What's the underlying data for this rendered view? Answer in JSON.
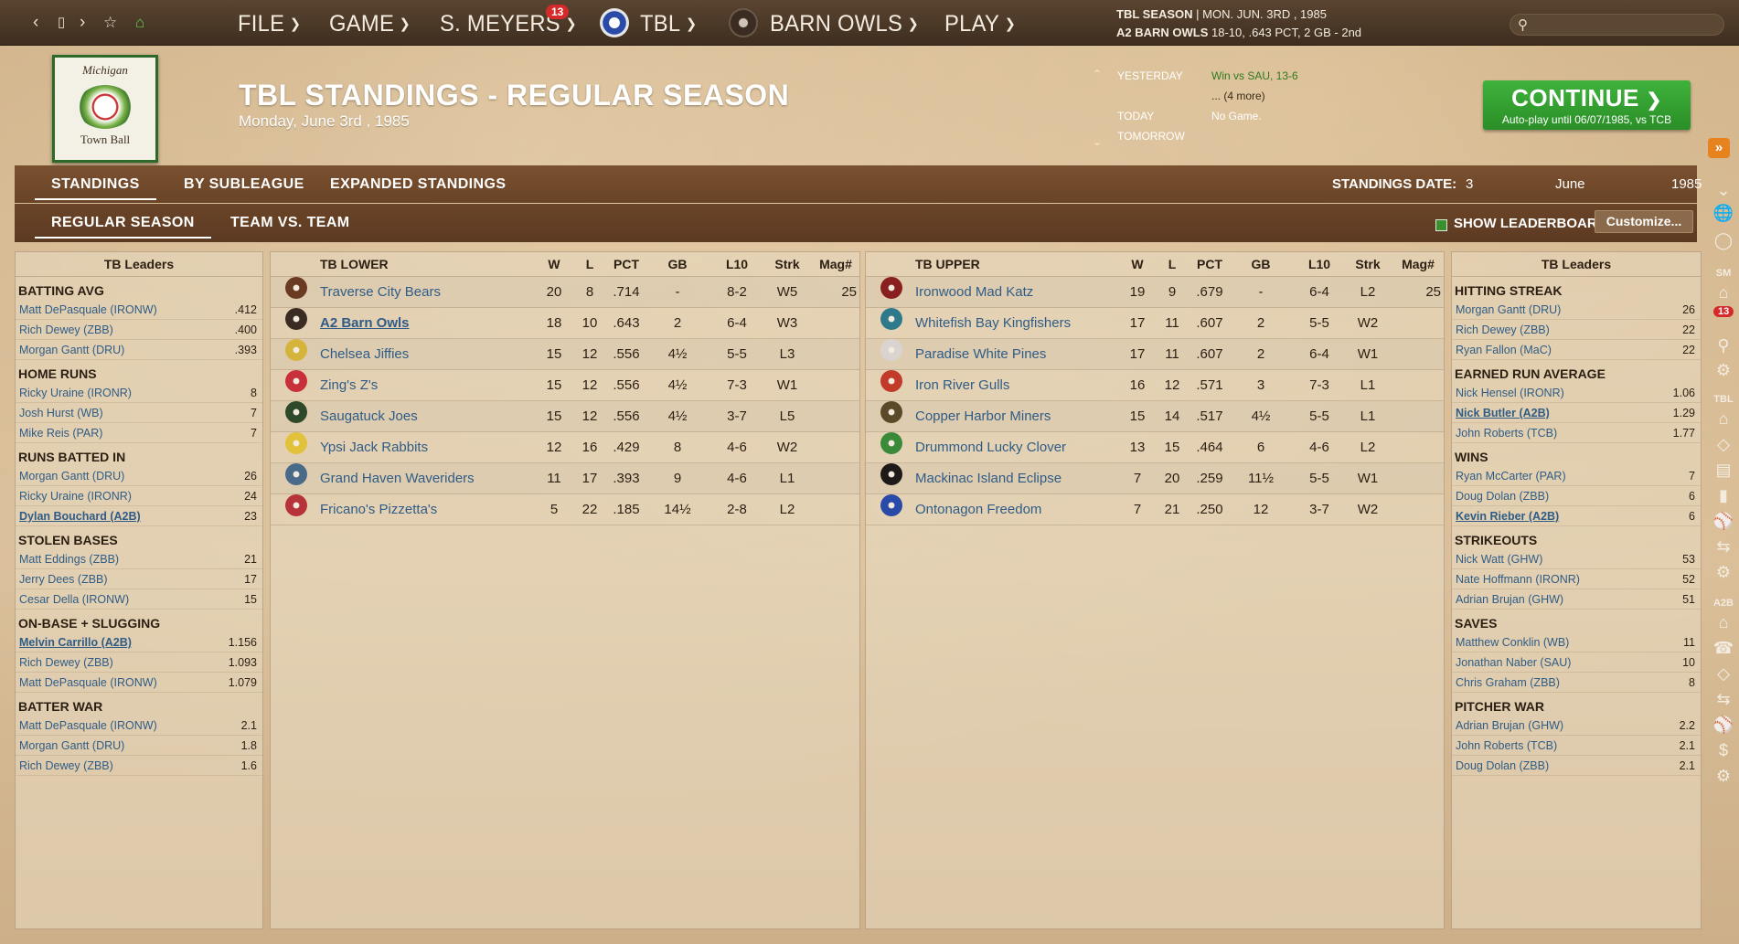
{
  "topbar": {
    "nav_icons": [
      "back-icon",
      "window-icon",
      "forward-icon",
      "star-icon",
      "home-icon"
    ],
    "menus": [
      "FILE",
      "GAME",
      "S. MEYERS",
      "TBL",
      "BARN OWLS",
      "PLAY"
    ],
    "notification_count": "13",
    "season_line1_bold": "TBL SEASON",
    "season_line1_rest": "  |  MON. JUN. 3RD , 1985",
    "season_line2_bold": "A2 BARN OWLS",
    "season_line2_rest": "  18-10, .643 PCT, 2 GB - 2nd"
  },
  "header": {
    "logo_top": "Michigan",
    "logo_bottom": "Town Ball",
    "title": "TBL STANDINGS - REGULAR SEASON",
    "date": "Monday, June 3rd , 1985",
    "schedule": {
      "yesterday_label": "YESTERDAY",
      "yesterday_value": "Win vs SAU, 13-6",
      "more": "... (4 more)",
      "today_label": "TODAY",
      "today_value": "No Game.",
      "tomorrow_label": "TOMORROW"
    },
    "continue_label": "CONTINUE",
    "continue_sub": "Auto-play until 06/07/1985, vs TCB"
  },
  "tabs1": {
    "standings": "STANDINGS",
    "by_subleague": "BY SUBLEAGUE",
    "expanded": "EXPANDED STANDINGS",
    "date_label": "STANDINGS DATE:",
    "day": "3",
    "month": "June",
    "year": "1985"
  },
  "tabs2": {
    "regular": "REGULAR SEASON",
    "team_vs_team": "TEAM VS. TEAM",
    "show_leaderboards": "SHOW LEADERBOARDS",
    "customize": "Customize..."
  },
  "left_leaders": {
    "title": "TB Leaders",
    "categories": [
      {
        "name": "BATTING AVG",
        "rows": [
          [
            "Matt DePasquale (IRONW)",
            ".412",
            false
          ],
          [
            "Rich Dewey (ZBB)",
            ".400",
            false
          ],
          [
            "Morgan Gantt (DRU)",
            ".393",
            false
          ]
        ]
      },
      {
        "name": "HOME RUNS",
        "rows": [
          [
            "Ricky Uraine (IRONR)",
            "8",
            false
          ],
          [
            "Josh Hurst (WB)",
            "7",
            false
          ],
          [
            "Mike Reis (PAR)",
            "7",
            false
          ]
        ]
      },
      {
        "name": "RUNS BATTED IN",
        "rows": [
          [
            "Morgan Gantt (DRU)",
            "26",
            false
          ],
          [
            "Ricky Uraine (IRONR)",
            "24",
            false
          ],
          [
            "Dylan Bouchard (A2B)",
            "23",
            true
          ]
        ]
      },
      {
        "name": "STOLEN BASES",
        "rows": [
          [
            "Matt Eddings (ZBB)",
            "21",
            false
          ],
          [
            "Jerry Dees (ZBB)",
            "17",
            false
          ],
          [
            "Cesar Della (IRONW)",
            "15",
            false
          ]
        ]
      },
      {
        "name": "ON-BASE + SLUGGING",
        "rows": [
          [
            "Melvin Carrillo (A2B)",
            "1.156",
            true
          ],
          [
            "Rich Dewey (ZBB)",
            "1.093",
            false
          ],
          [
            "Matt DePasquale (IRONW)",
            "1.079",
            false
          ]
        ]
      },
      {
        "name": "BATTER WAR",
        "rows": [
          [
            "Matt DePasquale (IRONW)",
            "2.1",
            false
          ],
          [
            "Morgan Gantt (DRU)",
            "1.8",
            false
          ],
          [
            "Rich Dewey (ZBB)",
            "1.6",
            false
          ]
        ]
      }
    ]
  },
  "right_leaders": {
    "title": "TB Leaders",
    "categories": [
      {
        "name": "HITTING STREAK",
        "rows": [
          [
            "Morgan Gantt (DRU)",
            "26",
            false
          ],
          [
            "Rich Dewey (ZBB)",
            "22",
            false
          ],
          [
            "Ryan Fallon (MaC)",
            "22",
            false
          ]
        ]
      },
      {
        "name": "EARNED RUN AVERAGE",
        "rows": [
          [
            "Nick Hensel (IRONR)",
            "1.06",
            false
          ],
          [
            "Nick Butler (A2B)",
            "1.29",
            true
          ],
          [
            "John Roberts (TCB)",
            "1.77",
            false
          ]
        ]
      },
      {
        "name": "WINS",
        "rows": [
          [
            "Ryan McCarter (PAR)",
            "7",
            false
          ],
          [
            "Doug Dolan (ZBB)",
            "6",
            false
          ],
          [
            "Kevin Rieber (A2B)",
            "6",
            true
          ]
        ]
      },
      {
        "name": "STRIKEOUTS",
        "rows": [
          [
            "Nick Watt (GHW)",
            "53",
            false
          ],
          [
            "Nate Hoffmann (IRONR)",
            "52",
            false
          ],
          [
            "Adrian Brujan (GHW)",
            "51",
            false
          ]
        ]
      },
      {
        "name": "SAVES",
        "rows": [
          [
            "Matthew Conklin (WB)",
            "11",
            false
          ],
          [
            "Jonathan Naber (SAU)",
            "10",
            false
          ],
          [
            "Chris Graham (ZBB)",
            "8",
            false
          ]
        ]
      },
      {
        "name": "PITCHER WAR",
        "rows": [
          [
            "Adrian Brujan (GHW)",
            "2.2",
            false
          ],
          [
            "John Roberts (TCB)",
            "2.1",
            false
          ],
          [
            "Doug Dolan (ZBB)",
            "2.1",
            false
          ]
        ]
      }
    ]
  },
  "lower": {
    "title": "TB LOWER",
    "columns": [
      "W",
      "L",
      "PCT",
      "GB",
      "L10",
      "Strk",
      "Mag#"
    ],
    "teams": [
      {
        "name": "Traverse City Bears",
        "w": "20",
        "l": "8",
        "pct": ".714",
        "gb": "-",
        "l10": "8-2",
        "strk": "W5",
        "mag": "25",
        "color": "#6b3a22",
        "ul": false
      },
      {
        "name": "A2 Barn Owls",
        "w": "18",
        "l": "10",
        "pct": ".643",
        "gb": "2",
        "l10": "6-4",
        "strk": "W3",
        "mag": "",
        "color": "#3a2c22",
        "ul": true
      },
      {
        "name": "Chelsea Jiffies",
        "w": "15",
        "l": "12",
        "pct": ".556",
        "gb": "4½",
        "l10": "5-5",
        "strk": "L3",
        "mag": "",
        "color": "#d4b43a",
        "ul": false
      },
      {
        "name": "Zing's Z's",
        "w": "15",
        "l": "12",
        "pct": ".556",
        "gb": "4½",
        "l10": "7-3",
        "strk": "W1",
        "mag": "",
        "color": "#c8313a",
        "ul": false
      },
      {
        "name": "Saugatuck Joes",
        "w": "15",
        "l": "12",
        "pct": ".556",
        "gb": "4½",
        "l10": "3-7",
        "strk": "L5",
        "mag": "",
        "color": "#2e4a2a",
        "ul": false
      },
      {
        "name": "Ypsi Jack Rabbits",
        "w": "12",
        "l": "16",
        "pct": ".429",
        "gb": "8",
        "l10": "4-6",
        "strk": "W2",
        "mag": "",
        "color": "#e2c23a",
        "ul": false
      },
      {
        "name": "Grand Haven Waveriders",
        "w": "11",
        "l": "17",
        "pct": ".393",
        "gb": "9",
        "l10": "4-6",
        "strk": "L1",
        "mag": "",
        "color": "#4a6a8a",
        "ul": false
      },
      {
        "name": "Fricano's Pizzetta's",
        "w": "5",
        "l": "22",
        "pct": ".185",
        "gb": "14½",
        "l10": "2-8",
        "strk": "L2",
        "mag": "",
        "color": "#b8323a",
        "ul": false
      }
    ]
  },
  "upper": {
    "title": "TB UPPER",
    "columns": [
      "W",
      "L",
      "PCT",
      "GB",
      "L10",
      "Strk",
      "Mag#"
    ],
    "teams": [
      {
        "name": "Ironwood Mad Katz",
        "w": "19",
        "l": "9",
        "pct": ".679",
        "gb": "-",
        "l10": "6-4",
        "strk": "L2",
        "mag": "25",
        "color": "#8a1f1f",
        "ul": false
      },
      {
        "name": "Whitefish Bay Kingfishers",
        "w": "17",
        "l": "11",
        "pct": ".607",
        "gb": "2",
        "l10": "5-5",
        "strk": "W2",
        "mag": "",
        "color": "#2f7a8a",
        "ul": false
      },
      {
        "name": "Paradise White Pines",
        "w": "17",
        "l": "11",
        "pct": ".607",
        "gb": "2",
        "l10": "6-4",
        "strk": "W1",
        "mag": "",
        "color": "#d9d4cf",
        "ul": false
      },
      {
        "name": "Iron River Gulls",
        "w": "16",
        "l": "12",
        "pct": ".571",
        "gb": "3",
        "l10": "7-3",
        "strk": "L1",
        "mag": "",
        "color": "#c23a2a",
        "ul": false
      },
      {
        "name": "Copper Harbor Miners",
        "w": "15",
        "l": "14",
        "pct": ".517",
        "gb": "4½",
        "l10": "5-5",
        "strk": "L1",
        "mag": "",
        "color": "#5a4a2a",
        "ul": false
      },
      {
        "name": "Drummond Lucky Clover",
        "w": "13",
        "l": "15",
        "pct": ".464",
        "gb": "6",
        "l10": "4-6",
        "strk": "L2",
        "mag": "",
        "color": "#3a8a3a",
        "ul": false
      },
      {
        "name": "Mackinac Island Eclipse",
        "w": "7",
        "l": "20",
        "pct": ".259",
        "gb": "11½",
        "l10": "5-5",
        "strk": "W1",
        "mag": "",
        "color": "#1e1a18",
        "ul": false
      },
      {
        "name": "Ontonagon Freedom",
        "w": "7",
        "l": "21",
        "pct": ".250",
        "gb": "12",
        "l10": "3-7",
        "strk": "W2",
        "mag": "",
        "color": "#2a4aa8",
        "ul": false
      }
    ]
  },
  "sidebar": {
    "labels": [
      "SM",
      "TBL",
      "A2B"
    ],
    "badge": "13"
  }
}
